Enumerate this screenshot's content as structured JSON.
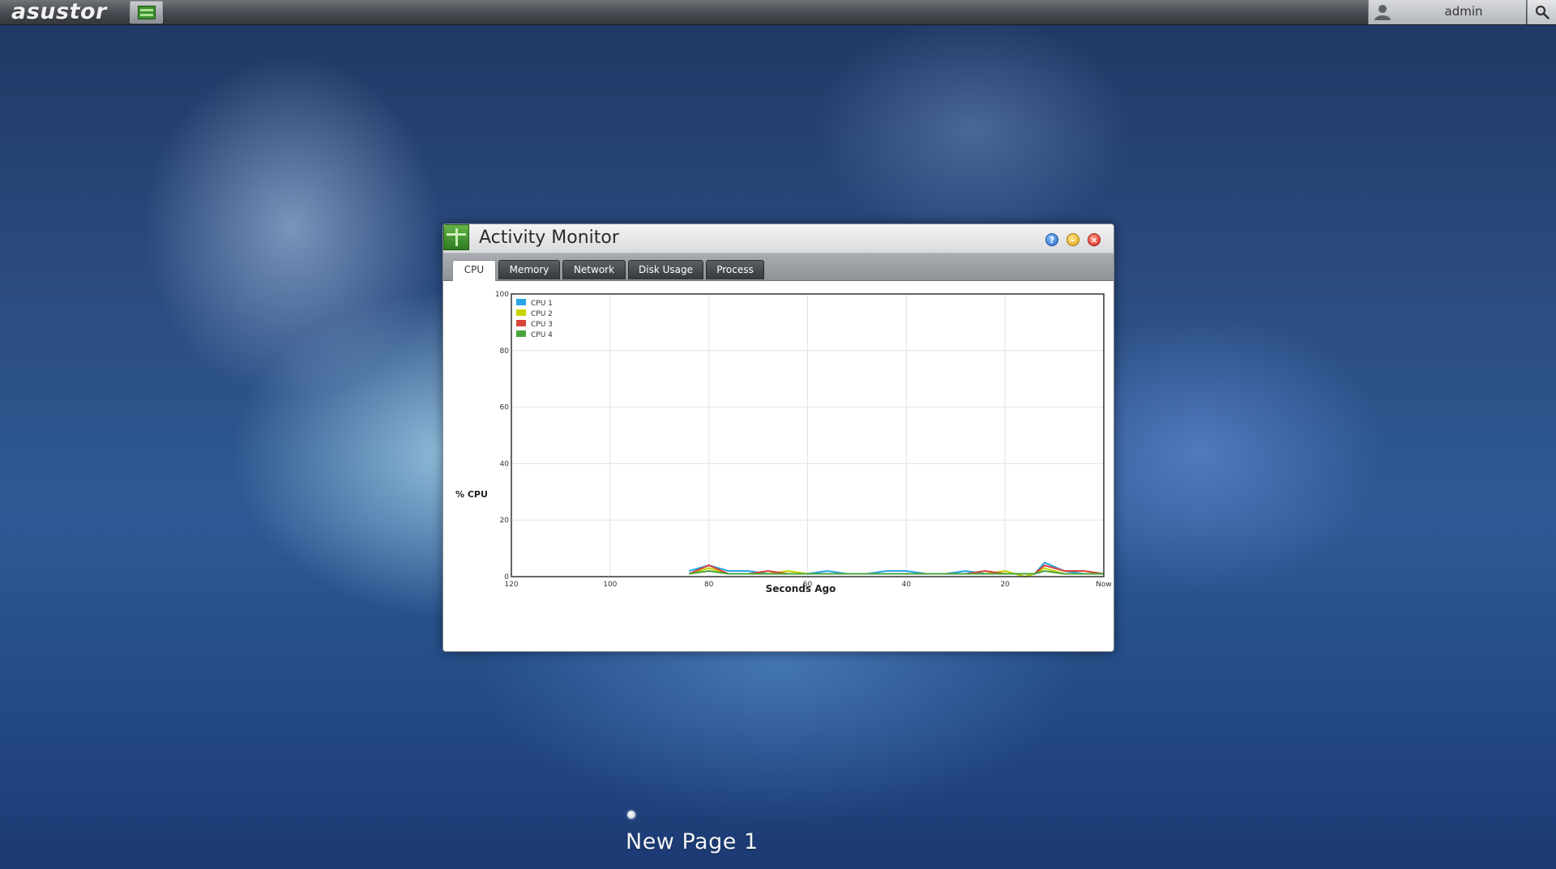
{
  "taskbar": {
    "logo_text": "asustor",
    "active_app_icon": "activity-monitor-icon",
    "user_name": "admin",
    "user_icon": "user-icon",
    "search_icon": "search-icon"
  },
  "window": {
    "title": "Activity Monitor",
    "controls": [
      "help-icon",
      "minimize-icon",
      "close-icon"
    ],
    "tabs": [
      {
        "label": "CPU",
        "active": true
      },
      {
        "label": "Memory",
        "active": false
      },
      {
        "label": "Network",
        "active": false
      },
      {
        "label": "Disk Usage",
        "active": false
      },
      {
        "label": "Process",
        "active": false
      }
    ]
  },
  "chart_data": {
    "type": "line",
    "title": "",
    "xlabel": "Seconds Ago",
    "ylabel": "% CPU",
    "xlim": [
      120,
      0
    ],
    "ylim": [
      0,
      100
    ],
    "x_ticks": [
      120,
      100,
      80,
      60,
      40,
      20,
      0
    ],
    "x_tick_labels": [
      "120",
      "100",
      "80",
      "60",
      "40",
      "20",
      "Now"
    ],
    "y_ticks": [
      0,
      20,
      40,
      60,
      80,
      100
    ],
    "grid": true,
    "legend_position": "top-left",
    "x": [
      84,
      80,
      76,
      72,
      68,
      64,
      60,
      56,
      52,
      48,
      44,
      40,
      36,
      32,
      28,
      24,
      20,
      16,
      14,
      12,
      8,
      4,
      0
    ],
    "series": [
      {
        "name": "CPU 1",
        "color": "#2aa4e8",
        "values": [
          2,
          4,
          2,
          2,
          1,
          1,
          1,
          2,
          1,
          1,
          2,
          2,
          1,
          1,
          2,
          1,
          1,
          1,
          1,
          5,
          2,
          1,
          1
        ]
      },
      {
        "name": "CPU 2",
        "color": "#c8d400",
        "values": [
          1,
          3,
          1,
          1,
          1,
          2,
          1,
          1,
          1,
          1,
          1,
          1,
          1,
          1,
          1,
          1,
          2,
          0,
          1,
          3,
          1,
          1,
          1
        ]
      },
      {
        "name": "CPU 3",
        "color": "#d9433a",
        "values": [
          1,
          4,
          1,
          1,
          2,
          1,
          1,
          1,
          1,
          1,
          1,
          1,
          1,
          1,
          1,
          2,
          1,
          1,
          1,
          4,
          2,
          2,
          1
        ]
      },
      {
        "name": "CPU 4",
        "color": "#4aa53c",
        "values": [
          1,
          2,
          1,
          1,
          1,
          1,
          1,
          1,
          1,
          1,
          1,
          1,
          1,
          1,
          1,
          1,
          1,
          1,
          1,
          2,
          1,
          1,
          1
        ]
      }
    ]
  },
  "desktop": {
    "page_label": "New Page 1"
  }
}
